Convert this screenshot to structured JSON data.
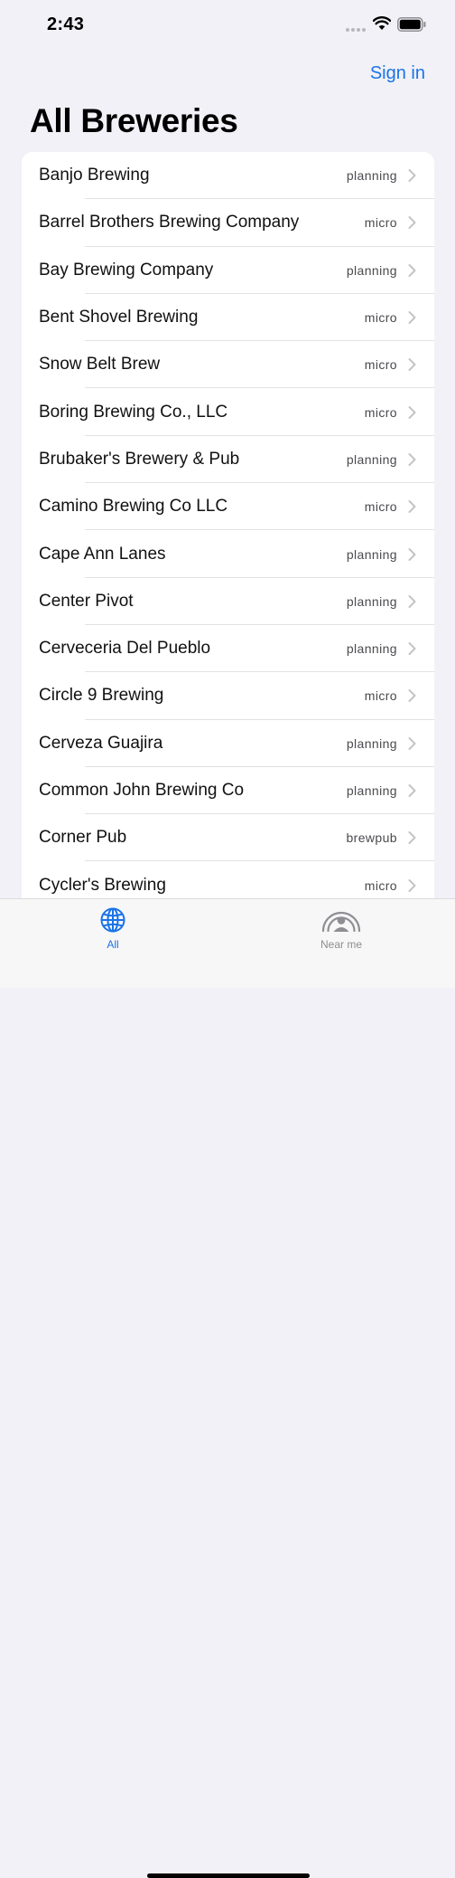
{
  "status_bar": {
    "time": "2:43"
  },
  "header": {
    "sign_in_label": "Sign in",
    "title": "All Breweries"
  },
  "colors": {
    "accent": "#1a73e8",
    "background": "#f2f1f7",
    "inactive_tab": "#8e8e93"
  },
  "breweries": [
    {
      "name": "Banjo Brewing",
      "type": "planning"
    },
    {
      "name": "Barrel Brothers Brewing Company",
      "type": "micro"
    },
    {
      "name": "Bay Brewing Company",
      "type": "planning"
    },
    {
      "name": "Bent Shovel Brewing",
      "type": "micro"
    },
    {
      "name": "Snow Belt Brew",
      "type": "micro"
    },
    {
      "name": "Boring Brewing Co., LLC",
      "type": "micro"
    },
    {
      "name": "Brubaker's Brewery & Pub",
      "type": "planning"
    },
    {
      "name": "Camino Brewing Co LLC",
      "type": "micro"
    },
    {
      "name": "Cape Ann Lanes",
      "type": "planning"
    },
    {
      "name": "Center Pivot",
      "type": "planning"
    },
    {
      "name": "Cerveceria Del Pueblo",
      "type": "planning"
    },
    {
      "name": "Circle 9 Brewing",
      "type": "micro"
    },
    {
      "name": "Cerveza Guajira",
      "type": "planning"
    },
    {
      "name": "Common John Brewing Co",
      "type": "planning"
    },
    {
      "name": "Corner Pub",
      "type": "brewpub"
    },
    {
      "name": "Cycler's Brewing",
      "type": "micro"
    }
  ],
  "tab_bar": {
    "tabs": [
      {
        "label": "All",
        "icon": "globe-icon",
        "selected": true
      },
      {
        "label": "Near me",
        "icon": "person-radar-icon",
        "selected": false
      }
    ]
  }
}
